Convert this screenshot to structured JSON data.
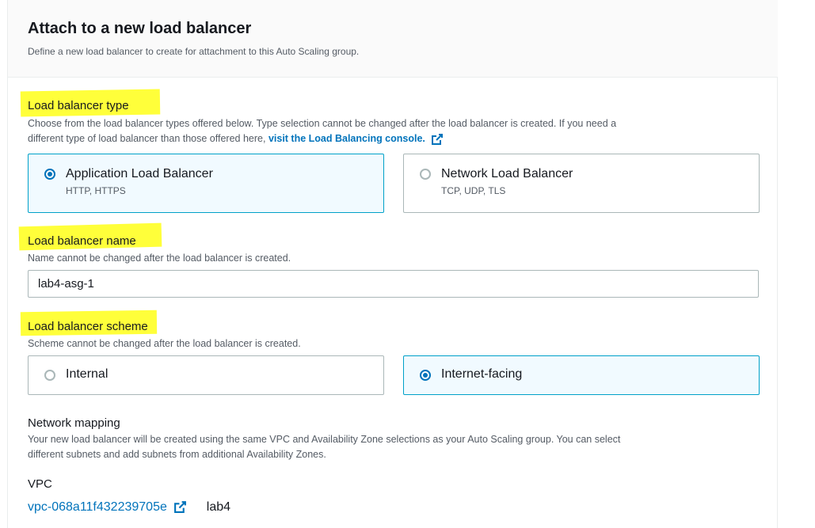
{
  "header": {
    "title": "Attach to a new load balancer",
    "description": "Define a new load balancer to create for attachment to this Auto Scaling group."
  },
  "lb_type": {
    "label": "Load balancer type",
    "description_line1": "Choose from the load balancer types offered below. Type selection cannot be changed after the load balancer is created. If you need a",
    "description_line2": "different type of load balancer than those offered here,",
    "link_text": "visit the Load Balancing console.",
    "options": [
      {
        "title": "Application Load Balancer",
        "subtitle": "HTTP, HTTPS",
        "selected": true
      },
      {
        "title": "Network Load Balancer",
        "subtitle": "TCP, UDP, TLS",
        "selected": false
      }
    ]
  },
  "lb_name": {
    "label": "Load balancer name",
    "description": "Name cannot be changed after the load balancer is created.",
    "value": "lab4-asg-1"
  },
  "lb_scheme": {
    "label": "Load balancer scheme",
    "description": "Scheme cannot be changed after the load balancer is created.",
    "options": [
      {
        "title": "Internal",
        "selected": false
      },
      {
        "title": "Internet-facing",
        "selected": true
      }
    ]
  },
  "network": {
    "label": "Network mapping",
    "description_line1": "Your new load balancer will be created using the same VPC and Availability Zone selections as your Auto Scaling group. You can select",
    "description_line2": "different subnets and add subnets from additional Availability Zones."
  },
  "vpc": {
    "label": "VPC",
    "id": "vpc-068a11f432239705e",
    "name": "lab4"
  },
  "colors": {
    "highlight": "#ffff3a",
    "link": "#0073bb",
    "selected_bg": "#f1faff",
    "selected_border": "#00a1c9"
  }
}
